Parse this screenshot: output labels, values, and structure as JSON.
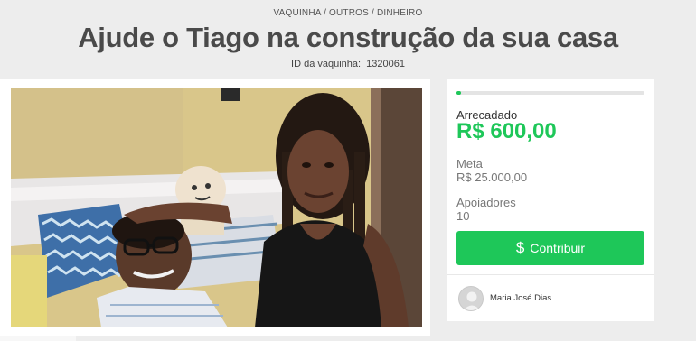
{
  "breadcrumb": {
    "part1": "VAQUINHA",
    "sep1": " / ",
    "part2": "OUTROS",
    "sep2": " / ",
    "part3": "DINHEIRO"
  },
  "title": "Ajude o Tiago na construção da sua casa",
  "vaquinha_id": {
    "label": "ID da vaquinha:",
    "value": "1320061"
  },
  "campaign": {
    "progress_fraction": 0.024,
    "raised_label": "Arrecadado",
    "raised_value": "R$ 600,00",
    "goal_label": "Meta",
    "goal_value": "R$ 25.000,00",
    "supporters_label": "Apoiadores",
    "supporters_value": "10",
    "contribute_icon": "$",
    "contribute_label": "Contribuir",
    "owner_name": "Maria José Dias"
  },
  "colors": {
    "accent": "#1ec759",
    "background": "#ededed"
  },
  "icons": {
    "contribute": "dollar-icon",
    "owner": "user-avatar-icon"
  }
}
